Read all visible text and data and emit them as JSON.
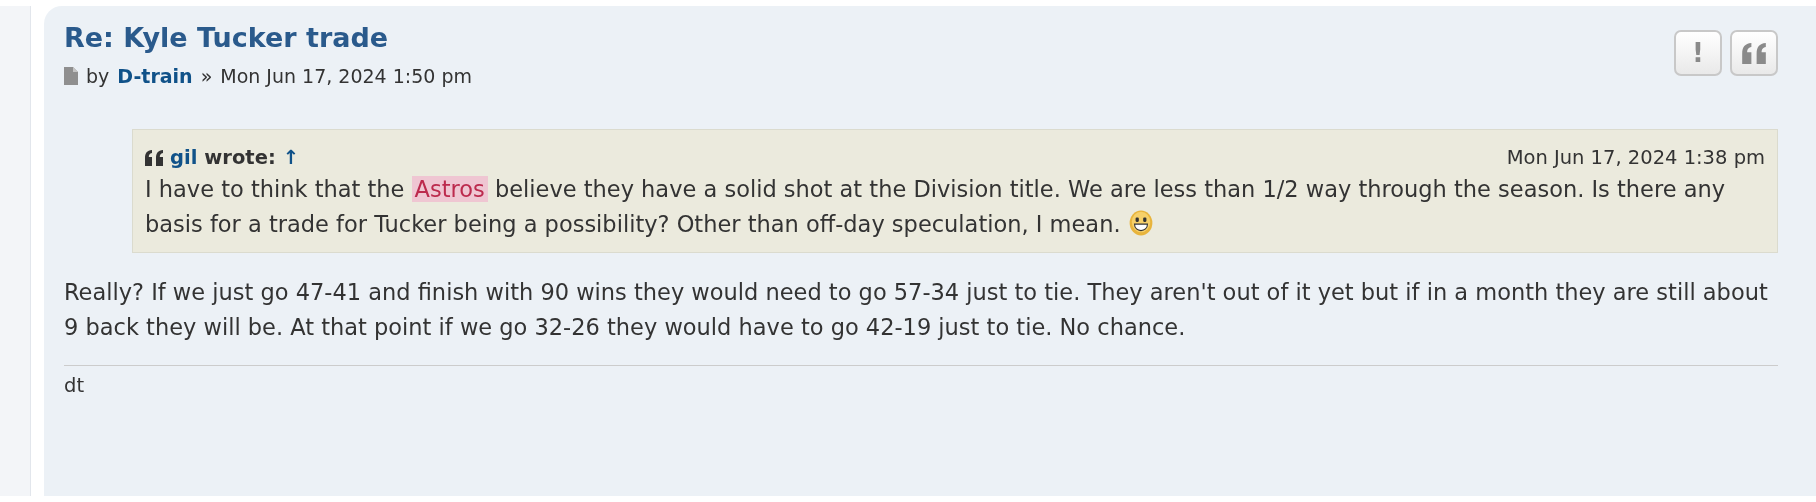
{
  "post": {
    "title": "Re: Kyle Tucker trade",
    "byline": {
      "prefix": "by",
      "author": "D-train",
      "separator": "»",
      "date": "Mon Jun 17, 2024 1:50 pm"
    },
    "buttons": [
      {
        "kind": "report",
        "label": "!"
      },
      {
        "kind": "quote"
      }
    ],
    "quote": {
      "author": "gil",
      "wrote": "wrote:",
      "link": "↑",
      "date": "Mon Jun 17, 2024 1:38 pm",
      "parts": [
        {
          "text": "I have to think that the ",
          "highlight": false
        },
        {
          "text": "Astros",
          "highlight": true
        },
        {
          "text": " believe they have a solid shot at the Division title. We are less than 1/2 way through the season. Is there any basis for a trade for Tucker being a possibility? Other than off-day speculation, I mean.",
          "highlight": false
        }
      ],
      "emoji": true
    },
    "body": "Really? If we just go 47-41 and finish with 90 wins they would need to go 57-34 just to tie. They aren't out of it yet but if in a month they are still about 9 back they will be. At that point if we go 32-26 they would have to go 42-19 just to tie. No chance.",
    "signature": "dt"
  }
}
